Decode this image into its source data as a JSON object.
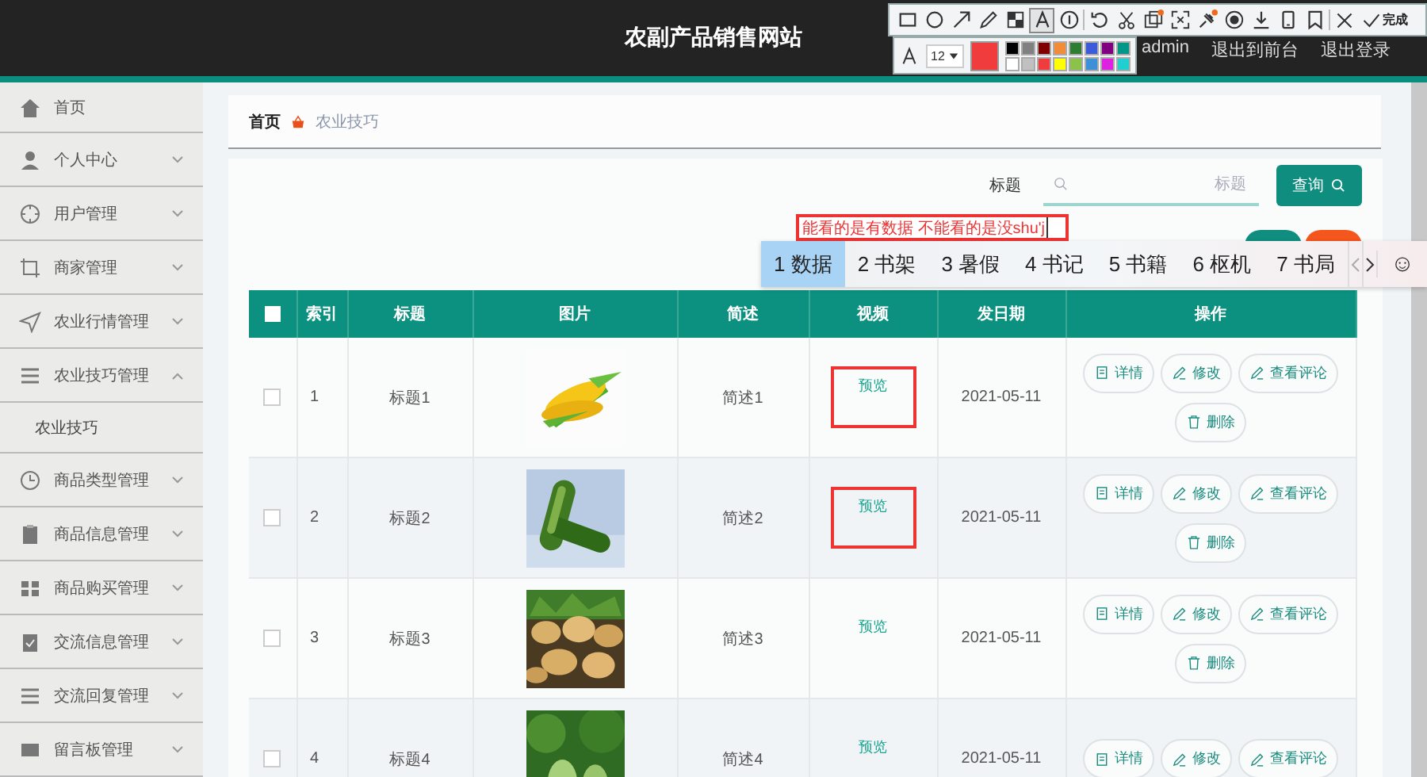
{
  "header": {
    "title": "农副产品销售网站",
    "links": [
      "admin",
      "退出到前台",
      "退出登录"
    ]
  },
  "sidebar": {
    "items": [
      {
        "label": "首页",
        "kind": "link"
      },
      {
        "label": "个人中心",
        "kind": "menu",
        "expanded": false
      },
      {
        "label": "用户管理",
        "kind": "menu",
        "expanded": false
      },
      {
        "label": "商家管理",
        "kind": "menu",
        "expanded": false
      },
      {
        "label": "农业行情管理",
        "kind": "menu",
        "expanded": false
      },
      {
        "label": "农业技巧管理",
        "kind": "menu",
        "expanded": true,
        "children": [
          {
            "label": "农业技巧"
          }
        ]
      },
      {
        "label": "商品类型管理",
        "kind": "menu",
        "expanded": false
      },
      {
        "label": "商品信息管理",
        "kind": "menu",
        "expanded": false
      },
      {
        "label": "商品购买管理",
        "kind": "menu",
        "expanded": false
      },
      {
        "label": "交流信息管理",
        "kind": "menu",
        "expanded": false
      },
      {
        "label": "交流回复管理",
        "kind": "menu",
        "expanded": false
      },
      {
        "label": "留言板管理",
        "kind": "menu",
        "expanded": false
      }
    ]
  },
  "breadcrumb": [
    "首页",
    "农业技巧"
  ],
  "search": {
    "label": "标题",
    "placeholder": "标题",
    "button": "查询"
  },
  "annotation_text": "能看的是有数据 不能看的是没shu'j",
  "ime": {
    "candidates": [
      {
        "label": "1 数据",
        "selected": true
      },
      {
        "label": "2 书架",
        "selected": false
      },
      {
        "label": "3 暑假",
        "selected": false
      },
      {
        "label": "4 书记",
        "selected": false
      },
      {
        "label": "5 书籍",
        "selected": false
      },
      {
        "label": "6 枢机",
        "selected": false
      },
      {
        "label": "7 书局",
        "selected": false
      }
    ],
    "emoji": "☺"
  },
  "table": {
    "all_checked": false,
    "columns": [
      "索引",
      "标题",
      "图片",
      "简述",
      "视频",
      "发日期",
      "操作"
    ],
    "rows": [
      {
        "checked": false,
        "index": "1",
        "title": "标题1",
        "image": {
          "kind": "picture"
        },
        "summary": "简述1",
        "video": "预览",
        "marked": true,
        "date": "2021-05-11",
        "actions": [
          "详情",
          "修改",
          "查看评论",
          "删除"
        ]
      },
      {
        "checked": false,
        "index": "2",
        "title": "标题2",
        "image": {
          "kind": "picture"
        },
        "summary": "简述2",
        "video": "预览",
        "marked": true,
        "date": "2021-05-11",
        "actions": [
          "详情",
          "修改",
          "查看评论",
          "删除"
        ]
      },
      {
        "checked": false,
        "index": "3",
        "title": "标题3",
        "image": {
          "kind": "picture"
        },
        "summary": "简述3",
        "video": "预览",
        "marked": false,
        "date": "2021-05-11",
        "actions": [
          "详情",
          "修改",
          "查看评论",
          "删除"
        ]
      },
      {
        "checked": false,
        "index": "4",
        "title": "标题4",
        "image": {
          "kind": "picture"
        },
        "summary": "简述4",
        "video": "预览",
        "marked": false,
        "date": "2021-05-11",
        "actions": [
          "详情",
          "修改",
          "查看评论"
        ]
      }
    ]
  },
  "toolbar": {
    "tools": [
      {
        "selected": false
      },
      {
        "selected": false
      },
      {
        "selected": false
      },
      {
        "selected": false
      },
      {
        "selected": false
      },
      {
        "selected": true
      },
      {
        "selected": false
      },
      {
        "selected": false
      },
      {
        "selected": false
      },
      {
        "selected": false
      },
      {
        "selected": false
      },
      {
        "selected": false
      },
      {
        "selected": false
      },
      {
        "selected": false
      },
      {
        "selected": false
      },
      {
        "selected": false
      }
    ],
    "done": "完成",
    "font_size": "12",
    "current_swatch": {
      "color": "#f03c3c"
    },
    "palette": [
      {
        "color": "#000000"
      },
      {
        "color": "#808080"
      },
      {
        "color": "#800000"
      },
      {
        "color": "#f28c38"
      },
      {
        "color": "#2e7d32"
      },
      {
        "color": "#3b5bdb"
      },
      {
        "color": "#800080"
      },
      {
        "color": "#009688"
      },
      {
        "color": "#ffffff"
      },
      {
        "color": "#c0c0c0"
      },
      {
        "color": "#f03c3c"
      },
      {
        "color": "#ffff00"
      },
      {
        "color": "#8bc34a"
      },
      {
        "color": "#3d8fd8"
      },
      {
        "color": "#e020e0"
      },
      {
        "color": "#20d0d0"
      }
    ]
  }
}
